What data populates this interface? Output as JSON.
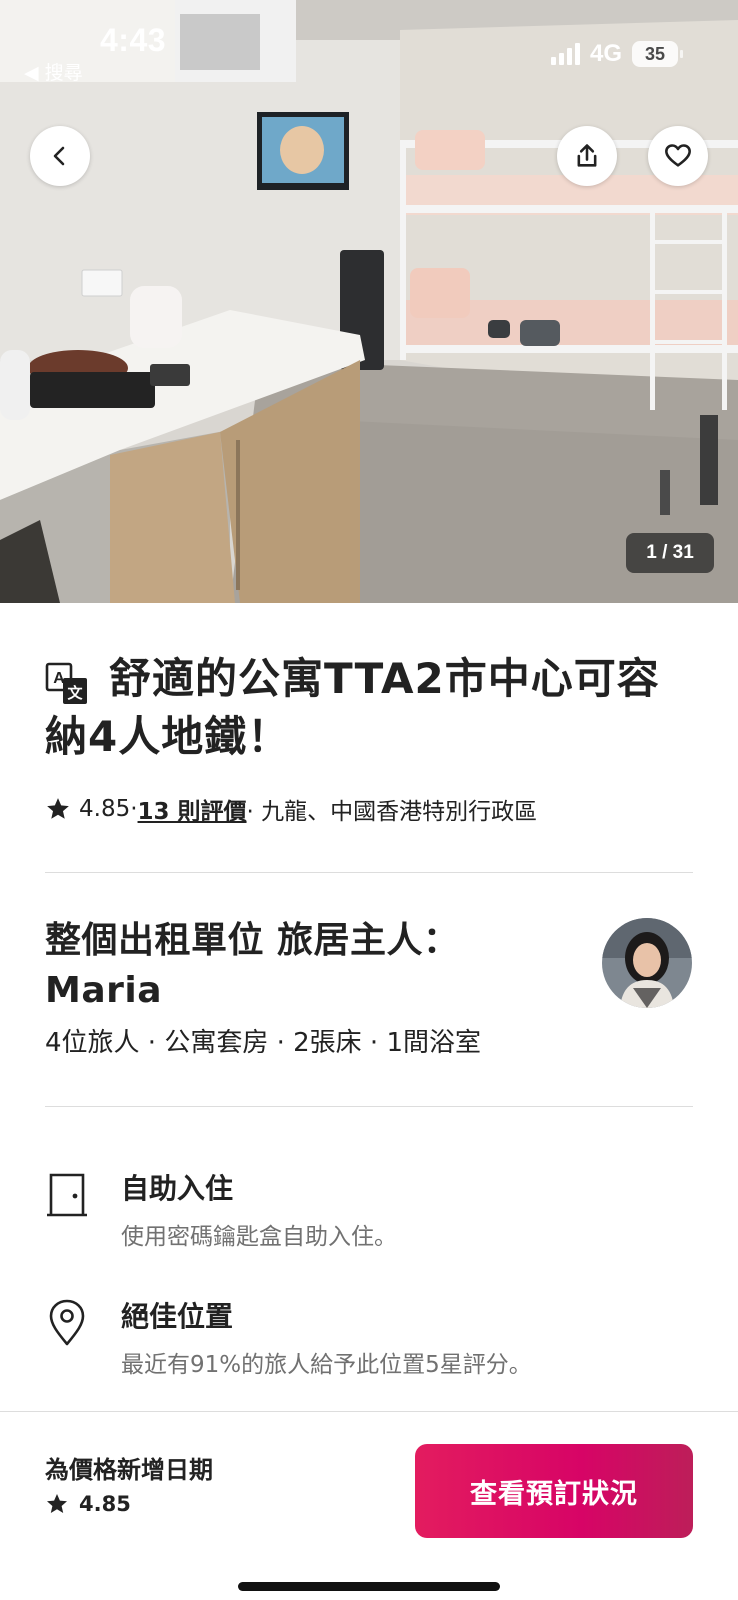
{
  "status_bar": {
    "time": "4:43",
    "back_app": "◀ 搜尋",
    "network": "4G",
    "battery": "35"
  },
  "photo": {
    "counter": "1 / 31",
    "alt_icon": "room-photo"
  },
  "nav": {
    "back_icon": "chevron-left-icon",
    "share_icon": "share-icon",
    "favorite_icon": "heart-icon"
  },
  "listing": {
    "title": "舒適的公寓TTA2市中心可容納4人地鐵！",
    "rating": "4.85",
    "sep1": " · ",
    "reviews_link": "13 則評價",
    "location": " · 九龍、中國香港特別行政區"
  },
  "host": {
    "title": "整個出租單位 旅居主人：Maria",
    "summary": "4位旅人 · 公寓套房 · 2張床 · 1間浴室"
  },
  "features": [
    {
      "icon": "door-icon",
      "title": "自助入住",
      "description": "使用密碼鑰匙盒自助入住。"
    },
    {
      "icon": "location-pin-icon",
      "title": "絕佳位置",
      "description": "最近有91%的旅人給予此位置5星評分。"
    }
  ],
  "bottom_bar": {
    "price_prompt": "為價格新增日期",
    "rating": "4.85",
    "reserve_button": "查看預訂狀況"
  },
  "colors": {
    "brand": "#e31c5f",
    "text": "#222222",
    "muted": "#717171",
    "divider": "#dddddd"
  }
}
